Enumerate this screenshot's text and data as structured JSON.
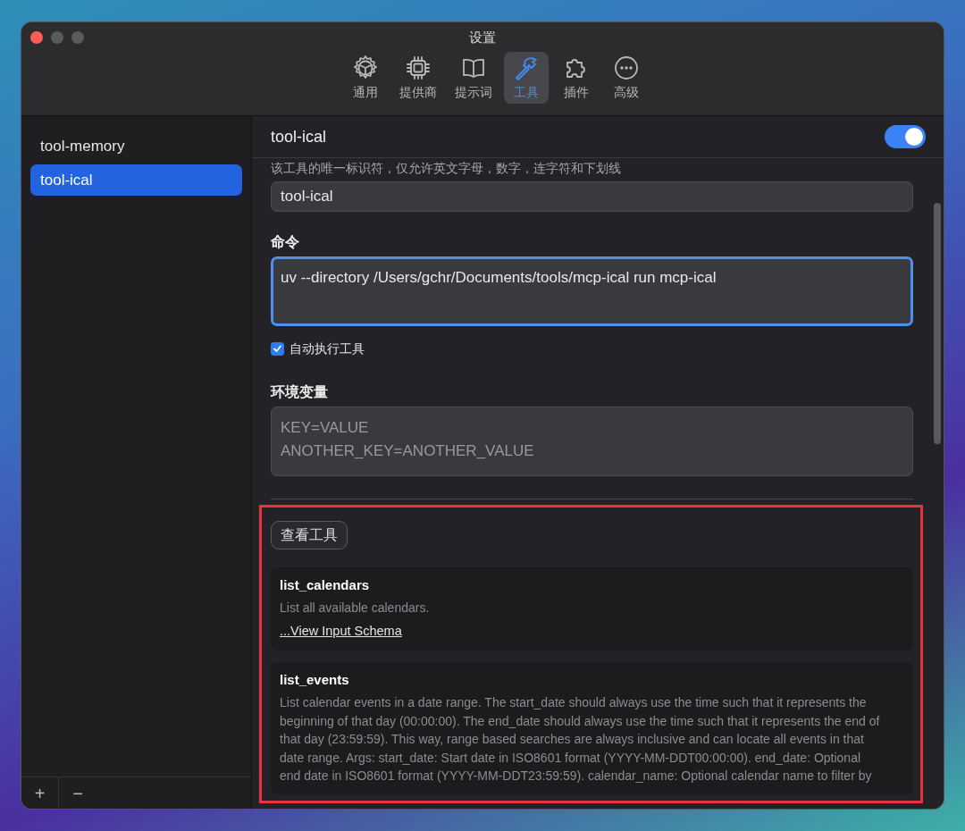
{
  "window": {
    "title": "设置"
  },
  "tabs": [
    {
      "label": "通用",
      "selected": false
    },
    {
      "label": "提供商",
      "selected": false
    },
    {
      "label": "提示词",
      "selected": false
    },
    {
      "label": "工具",
      "selected": true
    },
    {
      "label": "插件",
      "selected": false
    },
    {
      "label": "高级",
      "selected": false
    }
  ],
  "sidebar": {
    "items": [
      {
        "label": "tool-memory",
        "selected": false
      },
      {
        "label": "tool-ical",
        "selected": true
      }
    ],
    "add_button": "+",
    "remove_button": "−"
  },
  "detail": {
    "title": "tool-ical",
    "enabled": true,
    "id_hint": "该工具的唯一标识符，仅允许英文字母，数字，连字符和下划线",
    "id_value": "tool-ical",
    "command_label": "命令",
    "command_value": "uv --directory /Users/gchr/Documents/tools/mcp-ical run mcp-ical",
    "command_focused": true,
    "auto_run": {
      "label": "自动执行工具",
      "checked": true
    },
    "env_label": "环境变量",
    "env_placeholder": "KEY=VALUE\nANOTHER_KEY=ANOTHER_VALUE",
    "view_tools_button": "查看工具",
    "tools": [
      {
        "name": "list_calendars",
        "description": "List all available calendars.",
        "schema_link": "...View Input Schema"
      },
      {
        "name": "list_events",
        "description": "List calendar events in a date range. The start_date should always use the time such that it represents the beginning of that day (00:00:00). The end_date should always use the time such that it represents the end of that day (23:59:59). This way, range based searches are always inclusive and can locate all events in that date range. Args: start_date: Start date in ISO8601 format (YYYY-MM-DDT00:00:00). end_date: Optional end date in ISO8601 format (YYYY-MM-DDT23:59:59). calendar_name: Optional calendar name to filter by"
      }
    ]
  }
}
